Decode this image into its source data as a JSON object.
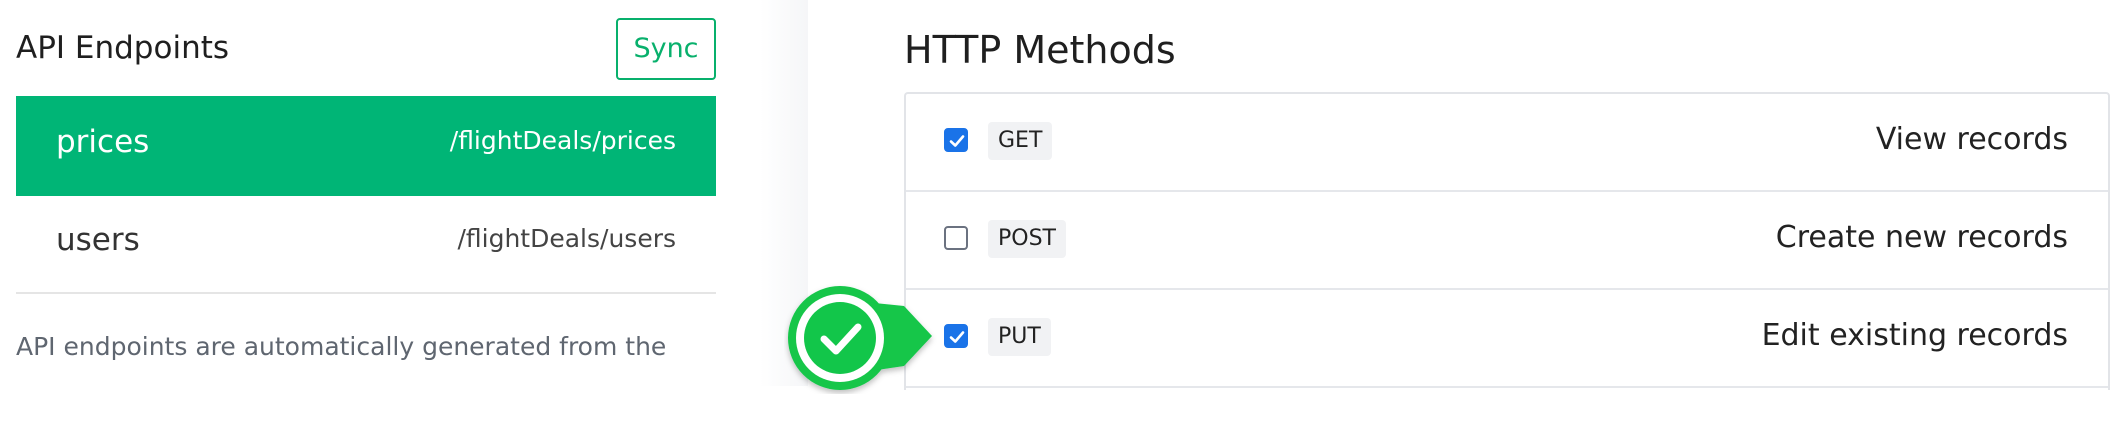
{
  "left_panel": {
    "title": "API Endpoints",
    "sync_label": "Sync",
    "endpoints": [
      {
        "name": "prices",
        "path": "/flightDeals/prices",
        "active": true
      },
      {
        "name": "users",
        "path": "/flightDeals/users",
        "active": false
      }
    ],
    "note": "API endpoints are automatically generated from the"
  },
  "right_panel": {
    "title": "HTTP Methods",
    "methods": [
      {
        "method": "GET",
        "description": "View records",
        "checked": true
      },
      {
        "method": "POST",
        "description": "Create new records",
        "checked": false
      },
      {
        "method": "PUT",
        "description": "Edit existing records",
        "checked": true
      }
    ]
  },
  "callout": {
    "icon": "checkmark-callout-icon"
  },
  "colors": {
    "accent_green": "#00b576",
    "checkbox_blue": "#1a73e8",
    "callout_green": "#12c64a"
  }
}
